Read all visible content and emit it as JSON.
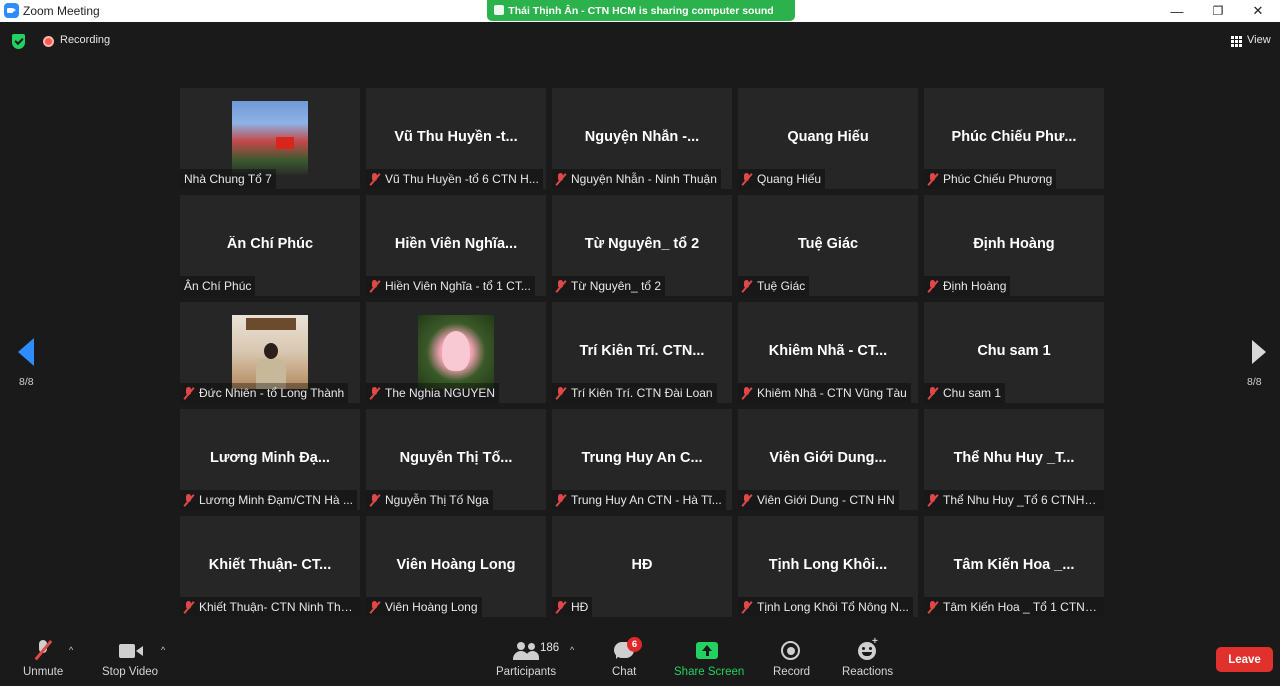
{
  "window": {
    "title": "Zoom Meeting",
    "minimize_glyph": "—",
    "restore_glyph": "❐",
    "close_glyph": "✕"
  },
  "sharing_banner": "Thái Thịnh Ân - CTN HCM is sharing computer sound",
  "topbar": {
    "recording_label": "Recording",
    "view_label": "View"
  },
  "pagination": {
    "left": "8/8",
    "right": "8/8"
  },
  "tiles": [
    {
      "big_name": "",
      "caption": "Nhà Chung Tổ 7",
      "muted": false,
      "photo": "group"
    },
    {
      "big_name": "Vũ Thu Huyền -t...",
      "caption": "Vũ Thu Huyền -tổ 6 CTN H...",
      "muted": true
    },
    {
      "big_name": "Nguyện Nhẫn -...",
      "caption": "Nguyện Nhẫn - Ninh Thuận",
      "muted": true
    },
    {
      "big_name": "Quang Hiếu",
      "caption": "Quang Hiếu",
      "muted": true
    },
    {
      "big_name": "Phúc Chiếu Phư...",
      "caption": "Phúc Chiếu Phương",
      "muted": true
    },
    {
      "big_name": "Ân Chí Phúc",
      "caption": "Ân Chí Phúc",
      "muted": false
    },
    {
      "big_name": "Hiền Viên Nghĩa...",
      "caption": "Hiền Viên Nghĩa - tổ 1 CT...",
      "muted": true
    },
    {
      "big_name": "Từ Nguyên_ tổ 2",
      "caption": "Từ Nguyên_ tổ 2",
      "muted": true
    },
    {
      "big_name": "Tuệ Giác",
      "caption": "Tuệ Giác",
      "muted": true
    },
    {
      "big_name": "Định Hoàng",
      "caption": "Định Hoàng",
      "muted": true
    },
    {
      "big_name": "",
      "caption": "Đức Nhiên - tổ Long Thành",
      "muted": true,
      "photo": "man"
    },
    {
      "big_name": "",
      "caption": "The Nghia NGUYEN",
      "muted": true,
      "photo": "lotus"
    },
    {
      "big_name": "Trí Kiên Trí. CTN...",
      "caption": "Trí Kiên Trí. CTN Đài Loan",
      "muted": true
    },
    {
      "big_name": "Khiêm Nhã - CT...",
      "caption": "Khiêm Nhã - CTN Vũng Tàu",
      "muted": true
    },
    {
      "big_name": "Chu sam 1",
      "caption": "Chu sam 1",
      "muted": true
    },
    {
      "big_name": "Lương Minh Đạ...",
      "caption": "Lương Minh Đạm/CTN Hà ...",
      "muted": true
    },
    {
      "big_name": "Nguyễn Thị Tố...",
      "caption": "Nguyễn Thị Tố Nga",
      "muted": true
    },
    {
      "big_name": "Trung Huy An  C...",
      "caption": "Trung Huy An  CTN - Hà Tĩ...",
      "muted": true
    },
    {
      "big_name": "Viên Giới Dung...",
      "caption": "Viên Giới Dung - CTN HN",
      "muted": true
    },
    {
      "big_name": "Thể Nhu Huy _T...",
      "caption": "Thể Nhu Huy _Tổ 6 CTNHC...",
      "muted": true
    },
    {
      "big_name": "Khiết Thuận- CT...",
      "caption": "Khiết Thuận- CTN Ninh Thu...",
      "muted": true
    },
    {
      "big_name": "Viên Hoàng Long",
      "caption": "Viên Hoàng Long",
      "muted": true
    },
    {
      "big_name": "HĐ",
      "caption": "HĐ",
      "muted": true
    },
    {
      "big_name": "Tịnh Long Khôi...",
      "caption": "Tịnh Long Khôi Tổ Nông N...",
      "muted": true
    },
    {
      "big_name": "Tâm Kiến Hoa _...",
      "caption": "Tâm Kiến Hoa _ Tổ 1 CTNH...",
      "muted": true
    }
  ],
  "toolbar": {
    "unmute_label": "Unmute",
    "stop_video_label": "Stop Video",
    "participants_label": "Participants",
    "participants_count": "186",
    "chat_label": "Chat",
    "chat_badge": "6",
    "share_screen_label": "Share Screen",
    "record_label": "Record",
    "reactions_label": "Reactions",
    "leave_label": "Leave",
    "caret_glyph": "^",
    "plus_glyph": "+"
  },
  "colors": {
    "accent_blue": "#2d8cff",
    "share_green": "#23d160",
    "leave_red": "#e0312c",
    "mute_red": "#e04848",
    "background": "#1a1a1a",
    "tile": "#262626"
  }
}
